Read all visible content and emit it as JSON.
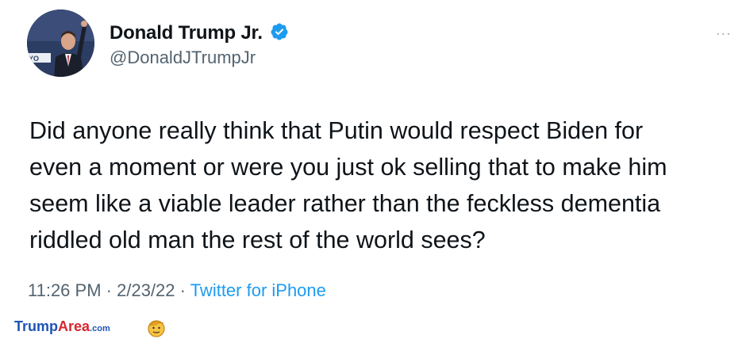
{
  "tweet": {
    "display_name": "Donald Trump Jr.",
    "handle": "@DonaldJTrumpJr",
    "verified_icon": "verified-badge-icon",
    "more_icon": "more-options-icon",
    "more_label": "...",
    "text": "Did anyone really think that Putin would respect Biden for\neven a moment or were you just ok selling that to make him\nseem like a viable leader rather than the feckless dementia\nriddled old man the rest of the world sees?",
    "time": "11:26 PM",
    "separator": "·",
    "date": "2/23/22",
    "source": "Twitter for iPhone"
  },
  "watermark": {
    "part1": "Trump",
    "part2": "Area",
    "part3": ".com"
  },
  "colors": {
    "text": "#0f1419",
    "secondary": "#536471",
    "link": "#1d9bf0",
    "verified": "#1d9bf0",
    "brand_blue": "#1d55b5",
    "brand_red": "#d7262d"
  }
}
